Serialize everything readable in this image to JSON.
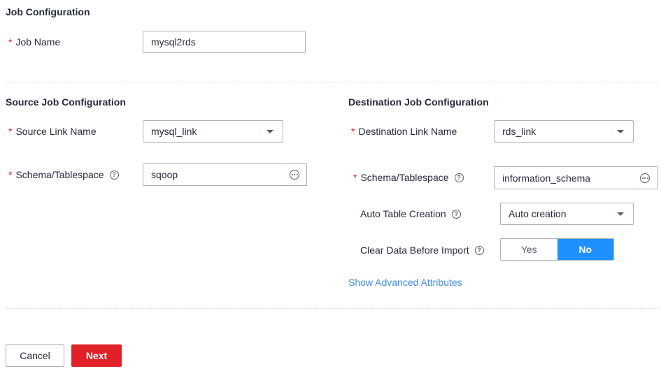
{
  "job_config": {
    "title": "Job Configuration",
    "job_name_label": "Job Name",
    "job_name_value": "mysql2rds"
  },
  "source": {
    "title": "Source Job Configuration",
    "link_name_label": "Source Link Name",
    "link_name_value": "mysql_link",
    "schema_label": "Schema/Tablespace",
    "schema_value": "sqoop"
  },
  "destination": {
    "title": "Destination Job Configuration",
    "link_name_label": "Destination Link Name",
    "link_name_value": "rds_link",
    "schema_label": "Schema/Tablespace",
    "schema_value": "information_schema",
    "auto_table_label": "Auto Table Creation",
    "auto_table_value": "Auto creation",
    "clear_data_label": "Clear Data Before Import",
    "clear_data_options": [
      "Yes",
      "No"
    ],
    "clear_data_selected": "No",
    "advanced_link": "Show Advanced Attributes"
  },
  "required_marker": "*",
  "help_glyph": "?",
  "icons": {
    "help": "question-circle-icon",
    "dropdown": "caret-down-icon",
    "browse": "ellipsis-circle-icon"
  },
  "colors": {
    "required": "#e02020",
    "toggle_active": "#1e90ff",
    "link": "#3f8ee8",
    "primary_button": "#e02128"
  },
  "footer": {
    "cancel_label": "Cancel",
    "next_label": "Next"
  }
}
